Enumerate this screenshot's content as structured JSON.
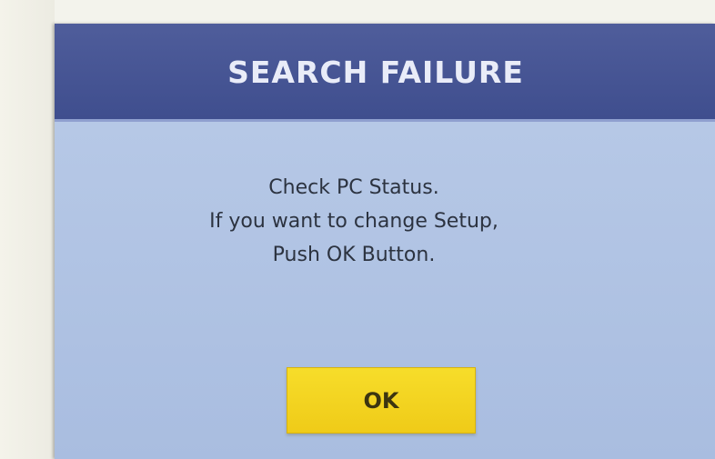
{
  "dialog": {
    "title": "SEARCH FAILURE",
    "message_lines": [
      "Check PC Status.",
      "If you want to change Setup,",
      "Push OK Button."
    ],
    "ok_label": "OK"
  },
  "colors": {
    "titlebar": "#44529a",
    "body": "#b0c4e4",
    "ok_button": "#f2d21e",
    "title_text": "#e9ecf8"
  }
}
